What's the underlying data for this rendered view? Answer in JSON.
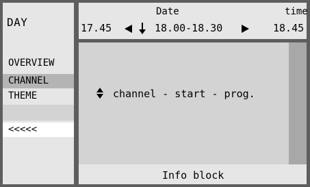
{
  "header": {
    "day_label": "DAY",
    "date_label": "Date",
    "time_label": "time",
    "prev_time": "17.45",
    "current_slot": "18.00-18.30",
    "next_time": "18.45"
  },
  "menu": {
    "items": [
      {
        "label": "OVERVIEW",
        "selected": false
      },
      {
        "label": "CHANNEL",
        "selected": true
      },
      {
        "label": "THEME",
        "selected": false
      },
      {
        "label": "",
        "selected": false
      },
      {
        "label": "<<<<<",
        "selected": false
      }
    ]
  },
  "main": {
    "sort_text": "channel - start - prog."
  },
  "info": {
    "label": "Info block"
  },
  "icons": {
    "left": "left-arrow-icon",
    "right": "right-arrow-icon",
    "down": "down-arrow-icon",
    "sort": "sort-up-down-icon"
  },
  "colors": {
    "frame": "#5e5e5e",
    "panel": "#e6e6e6",
    "main": "#d3d3d3",
    "selected": "#b4b4b4",
    "scrollbar": "#a8a8a8"
  }
}
